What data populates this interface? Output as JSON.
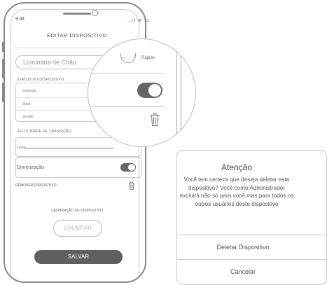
{
  "phone": {
    "time": "9:41",
    "status_icons": "..ıl ᯤ ▭",
    "title": "EDITAR DISPOSITIVO",
    "name_placeholder": "Luminária de Chão",
    "status_label": "STATUS DO DISPOSITIVO",
    "status_rows": [
      "Conexão",
      "Sinal",
      "Versão"
    ],
    "speed_label": "VELOCIDADE DE TRANSIÇÃO",
    "speed_min": "Lento",
    "dimming_label": "Dimerização",
    "remove_label": "REMOVER DISPOSITIVO",
    "calibration_label": "CALIBRAÇÃO DE DISPOSITIVO",
    "calibrate_button": "CALIBRAR",
    "save_button": "SALVAR"
  },
  "magnifier": {
    "speed_max": "Rápido"
  },
  "dialog": {
    "title": "Atenção",
    "message": "Você tem certeza que deseja deletar este dispositivo? Você como Administrador excluirá não só para você mas para todos os outros usuários deste dispositivo",
    "delete_button": "Deletar Dispositivo",
    "cancel_button": "Cancelar"
  }
}
